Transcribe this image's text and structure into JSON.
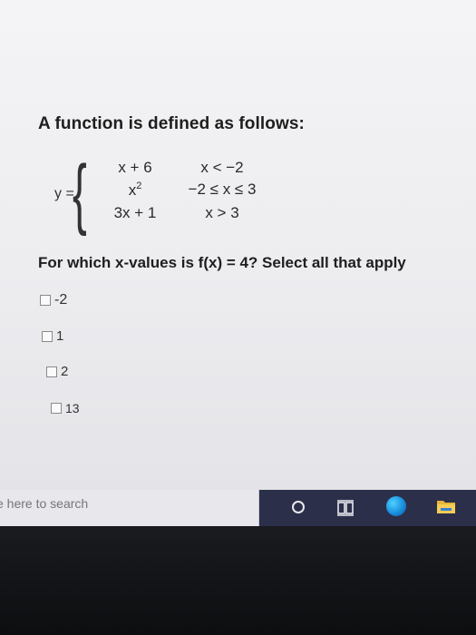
{
  "question": {
    "title": "A function is defined as follows:",
    "piecewise": {
      "lhs": "y =",
      "rows": [
        {
          "expr": "x + 6",
          "cond": "x < −2"
        },
        {
          "expr": "x",
          "expr_sup": "2",
          "cond": "−2 ≤ x ≤ 3"
        },
        {
          "expr": "3x + 1",
          "cond": "x > 3"
        }
      ]
    },
    "prompt": "For which x-values is f(x) = 4? Select all that apply",
    "options": [
      "-2",
      "1",
      "2",
      "13"
    ]
  },
  "taskbar": {
    "search_placeholder": "e here to search",
    "icons": [
      "cortana-icon",
      "task-view-icon",
      "edge-icon",
      "file-explorer-icon"
    ]
  }
}
